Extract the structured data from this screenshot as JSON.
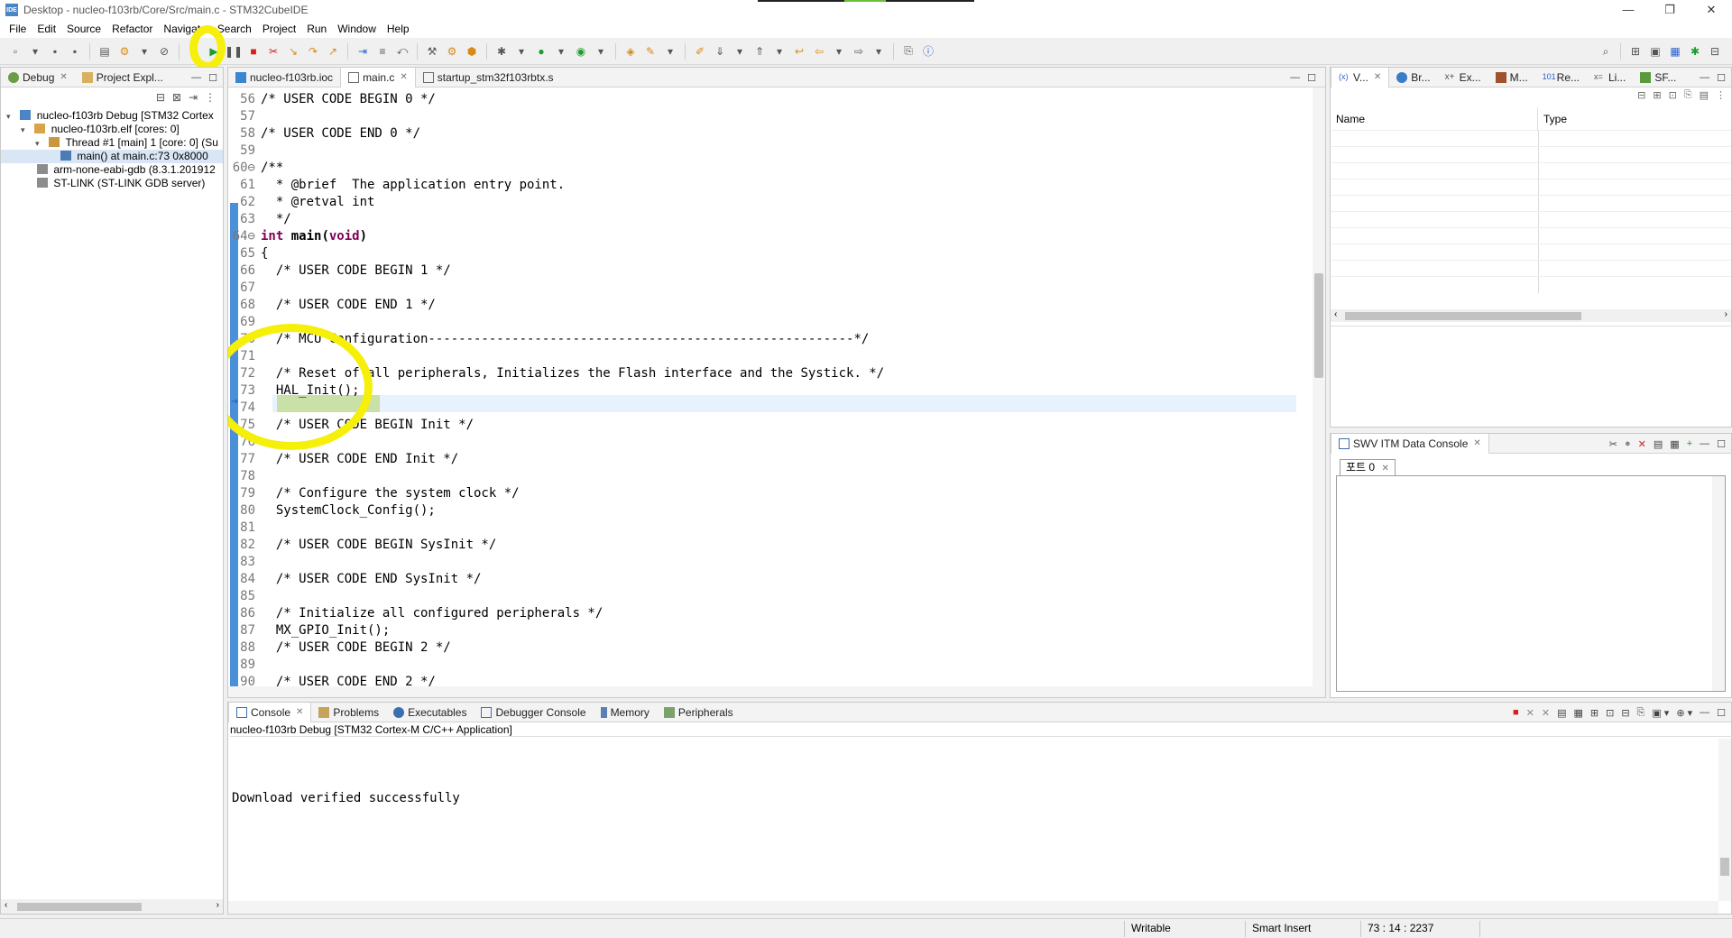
{
  "window": {
    "title": "Desktop - nucleo-f103rb/Core/Src/main.c - STM32CubeIDE",
    "app_icon": "IDE",
    "controls": [
      "—",
      "❐",
      "✕"
    ]
  },
  "menu": [
    "File",
    "Edit",
    "Source",
    "Refactor",
    "Navigate",
    "Search",
    "Project",
    "Run",
    "Window",
    "Help"
  ],
  "left_panel": {
    "tabs": [
      {
        "label": "Debug",
        "icon": "debug-bug-icon"
      },
      {
        "label": "Project Expl...",
        "icon": "folder-icon"
      }
    ],
    "tree": [
      {
        "label": "nucleo-f103rb Debug [STM32 Cortex",
        "indent": 0,
        "expander": "▾",
        "icon": "ide-launch-icon"
      },
      {
        "label": "nucleo-f103rb.elf [cores: 0]",
        "indent": 1,
        "expander": "▾",
        "icon": "elf-process-icon"
      },
      {
        "label": "Thread #1 [main] 1 [core: 0] (Su",
        "indent": 2,
        "expander": "▾",
        "icon": "thread-icon"
      },
      {
        "label": "main() at main.c:73 0x8000",
        "indent": 3,
        "expander": "",
        "icon": "stack-frame-icon",
        "selected": true
      },
      {
        "label": "arm-none-eabi-gdb (8.3.1.201912",
        "indent": 1,
        "expander": "",
        "icon": "gdb-process-icon"
      },
      {
        "label": "ST-LINK (ST-LINK GDB server)",
        "indent": 1,
        "expander": "",
        "icon": "stlink-process-icon"
      }
    ]
  },
  "editor": {
    "tabs": [
      {
        "label": "nucleo-f103rb.ioc",
        "icon": "mx-icon",
        "active": false
      },
      {
        "label": "main.c",
        "icon": "c-file-icon",
        "active": true
      },
      {
        "label": "startup_stm32f103rbtx.s",
        "icon": "asm-file-icon",
        "active": false
      }
    ],
    "lines": [
      {
        "n": "56",
        "text": "/* USER CODE BEGIN 0 */",
        "type": "cmt"
      },
      {
        "n": "57",
        "text": "",
        "type": ""
      },
      {
        "n": "58",
        "text": "/* USER CODE END 0 */",
        "type": "cmt"
      },
      {
        "n": "59",
        "text": "",
        "type": ""
      },
      {
        "n": "60⊖",
        "text": "/**",
        "type": "cmt"
      },
      {
        "n": "61",
        "text": "  * @brief  The application entry point.",
        "type": "cmt"
      },
      {
        "n": "62",
        "text": "  * @retval int",
        "type": "cmt"
      },
      {
        "n": "63",
        "text": "  */",
        "type": "cmt"
      },
      {
        "n": "64⊖",
        "text": "int main(void)",
        "type": "kw"
      },
      {
        "n": "65",
        "text": "{",
        "type": ""
      },
      {
        "n": "66",
        "text": "  /* USER CODE BEGIN 1 */",
        "type": "cmt"
      },
      {
        "n": "67",
        "text": "",
        "type": ""
      },
      {
        "n": "68",
        "text": "  /* USER CODE END 1 */",
        "type": "cmt"
      },
      {
        "n": "69",
        "text": "",
        "type": ""
      },
      {
        "n": "70",
        "text": "  /* MCU Configuration--------------------------------------------------------*/",
        "type": "cmt"
      },
      {
        "n": "71",
        "text": "",
        "type": ""
      },
      {
        "n": "72",
        "text": "  /* Reset of all peripherals, Initializes the Flash interface and the Systick. */",
        "type": "cmt"
      },
      {
        "n": "73",
        "text": "  HAL_Init();",
        "type": "cur"
      },
      {
        "n": "74",
        "text": "",
        "type": ""
      },
      {
        "n": "75",
        "text": "  /* USER CODE BEGIN Init */",
        "type": "cmt"
      },
      {
        "n": "76",
        "text": "",
        "type": ""
      },
      {
        "n": "77",
        "text": "  /* USER CODE END Init */",
        "type": "cmt"
      },
      {
        "n": "78",
        "text": "",
        "type": ""
      },
      {
        "n": "79",
        "text": "  /* Configure the system clock */",
        "type": "cmt"
      },
      {
        "n": "80",
        "text": "  SystemClock_Config();",
        "type": ""
      },
      {
        "n": "81",
        "text": "",
        "type": ""
      },
      {
        "n": "82",
        "text": "  /* USER CODE BEGIN SysInit */",
        "type": "cmt"
      },
      {
        "n": "83",
        "text": "",
        "type": ""
      },
      {
        "n": "84",
        "text": "  /* USER CODE END SysInit */",
        "type": "cmt"
      },
      {
        "n": "85",
        "text": "",
        "type": ""
      },
      {
        "n": "86",
        "text": "  /* Initialize all configured peripherals */",
        "type": "cmt"
      },
      {
        "n": "87",
        "text": "  MX_GPIO_Init();",
        "type": ""
      },
      {
        "n": "88",
        "text": "  /* USER CODE BEGIN 2 */",
        "type": "cmt"
      },
      {
        "n": "89",
        "text": "",
        "type": ""
      },
      {
        "n": "90",
        "text": "  /* USER CODE END 2 */",
        "type": "cmt"
      }
    ]
  },
  "right_top": {
    "tabs": [
      "V...",
      "Br...",
      "Ex...",
      "M...",
      "Re...",
      "Li...",
      "SF..."
    ],
    "columns": [
      "Name",
      "Type"
    ]
  },
  "swv": {
    "title": "SWV ITM Data Console",
    "port_tab": "포트 0"
  },
  "console": {
    "tabs": [
      "Console",
      "Problems",
      "Executables",
      "Debugger Console",
      "Memory",
      "Peripherals"
    ],
    "launch_label": "nucleo-f103rb Debug [STM32 Cortex-M C/C++ Application]",
    "output": "Download verified successfully"
  },
  "status": {
    "mode": "Writable",
    "insert": "Smart Insert",
    "position": "73 : 14 : 2237"
  },
  "colors": {
    "highlight_ring": "#f5ef0a",
    "breakpoint_bar": "#4a90d9",
    "comment": "#3f7f5f",
    "keyword": "#7f0055"
  }
}
